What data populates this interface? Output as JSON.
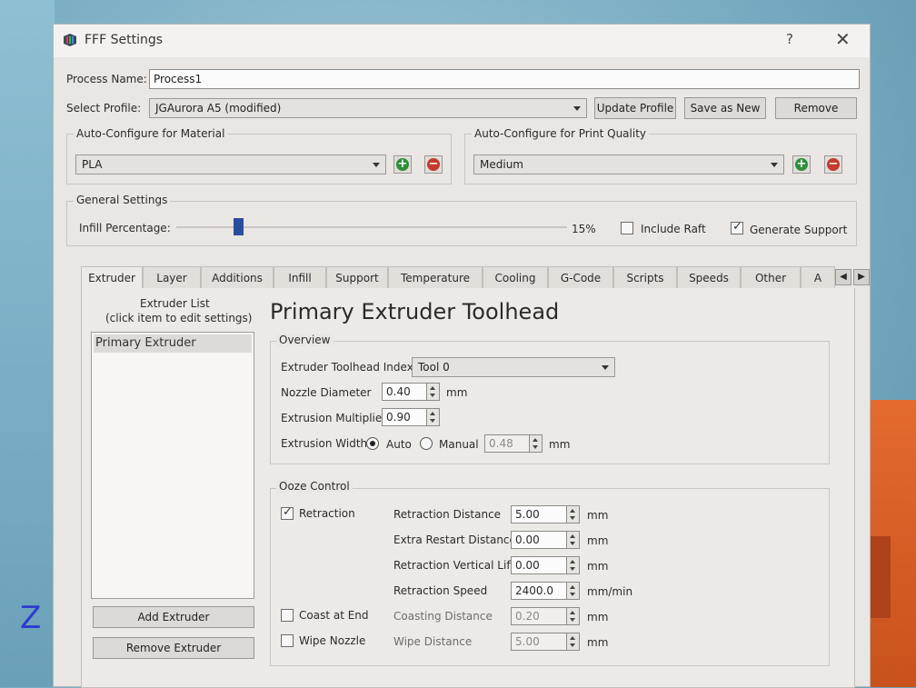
{
  "window": {
    "title": "FFF Settings",
    "help": "?",
    "close": "✕"
  },
  "process": {
    "label": "Process Name:",
    "value": "Process1"
  },
  "profile": {
    "label": "Select Profile:",
    "value": "JGAurora A5 (modified)",
    "update_label": "Update Profile",
    "save_new_label": "Save as New",
    "remove_label": "Remove"
  },
  "auto_material": {
    "label": "Auto-Configure for Material",
    "value": "PLA"
  },
  "auto_quality": {
    "label": "Auto-Configure for Print Quality",
    "value": "Medium"
  },
  "general": {
    "label": "General Settings",
    "infill_label": "Infill Percentage:",
    "infill_value": "15%",
    "infill_fraction": 0.15,
    "include_raft_label": "Include Raft",
    "include_raft_checked": false,
    "generate_support_label": "Generate Support",
    "generate_support_checked": true
  },
  "tabs": [
    "Extruder",
    "Layer",
    "Additions",
    "Infill",
    "Support",
    "Temperature",
    "Cooling",
    "G-Code",
    "Scripts",
    "Speeds",
    "Other",
    "A"
  ],
  "extruder_list": {
    "title_line1": "Extruder List",
    "title_line2": "(click item to edit settings)",
    "items": [
      "Primary Extruder"
    ],
    "add_label": "Add Extruder",
    "remove_label": "Remove Extruder"
  },
  "toolhead": {
    "heading": "Primary Extruder Toolhead",
    "overview_label": "Overview",
    "index_label": "Extruder Toolhead Index",
    "index_value": "Tool 0",
    "nozzle_label": "Nozzle Diameter",
    "nozzle_value": "0.40",
    "nozzle_unit": "mm",
    "multiplier_label": "Extrusion Multiplier",
    "multiplier_value": "0.90",
    "width_label": "Extrusion Width",
    "width_auto_label": "Auto",
    "width_manual_label": "Manual",
    "width_value": "0.48",
    "width_unit": "mm"
  },
  "ooze": {
    "label": "Ooze Control",
    "retraction_label": "Retraction",
    "coast_label": "Coast at End",
    "wipe_label": "Wipe Nozzle",
    "fields": [
      {
        "label": "Retraction Distance",
        "value": "5.00",
        "unit": "mm"
      },
      {
        "label": "Extra Restart Distance",
        "value": "0.00",
        "unit": "mm"
      },
      {
        "label": "Retraction Vertical Lift",
        "value": "0.00",
        "unit": "mm"
      },
      {
        "label": "Retraction Speed",
        "value": "2400.0",
        "unit": "mm/min"
      },
      {
        "label": "Coasting Distance",
        "value": "0.20",
        "unit": "mm"
      },
      {
        "label": "Wipe Distance",
        "value": "5.00",
        "unit": "mm"
      }
    ]
  },
  "scene": {
    "axis_label": "Z"
  },
  "colors": {
    "slider_handle": "#2b4d9e",
    "plus_green": "#2f8f3a",
    "minus_red": "#c43a2c"
  }
}
